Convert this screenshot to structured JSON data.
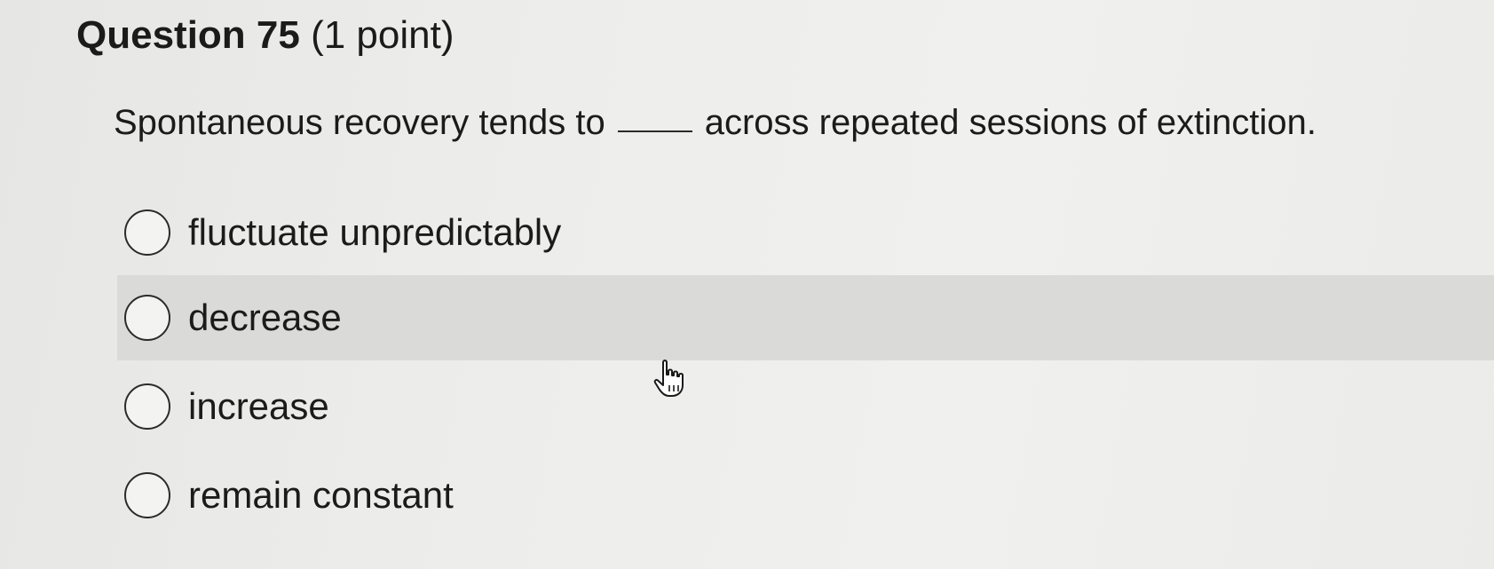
{
  "question": {
    "title": "Question 75",
    "points": "(1 point)",
    "prompt_before": "Spontaneous recovery tends to",
    "prompt_after": "across repeated sessions of extinction."
  },
  "options": [
    {
      "label": "fluctuate unpredictably",
      "selected": false
    },
    {
      "label": "decrease",
      "selected": false,
      "hovered": true
    },
    {
      "label": "increase",
      "selected": false
    },
    {
      "label": "remain constant",
      "selected": false
    }
  ],
  "cursor": {
    "icon": "hand-pointer-icon"
  }
}
